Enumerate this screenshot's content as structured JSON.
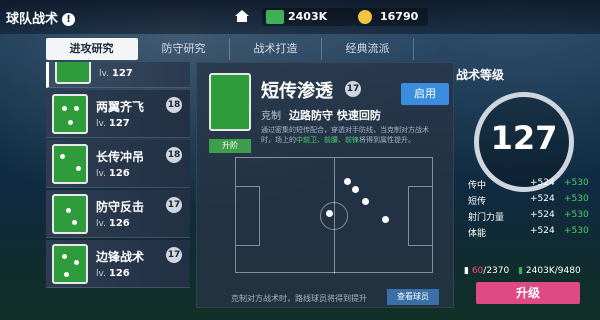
{
  "header": {
    "title": "球队战术",
    "resources": [
      {
        "icon": "cash-icon",
        "value": "2403K"
      },
      {
        "icon": "coin-icon",
        "value": "16790"
      }
    ]
  },
  "tabs": [
    "进攻研究",
    "防守研究",
    "战术打造",
    "经典流派"
  ],
  "tactic_list": [
    {
      "name": "",
      "level_prefix": "lv.",
      "level": "127",
      "badge": ""
    },
    {
      "name": "两翼齐飞",
      "level_prefix": "lv.",
      "level": "127",
      "badge": "18"
    },
    {
      "name": "长传冲吊",
      "level_prefix": "lv.",
      "level": "126",
      "badge": "18"
    },
    {
      "name": "防守反击",
      "level_prefix": "lv.",
      "level": "126",
      "badge": "17"
    },
    {
      "name": "边锋战术",
      "level_prefix": "lv.",
      "level": "126",
      "badge": "17"
    }
  ],
  "detail": {
    "name": "短传渗透",
    "badge": "17",
    "apply_label": "启用",
    "counter_label": "克制",
    "counters": "边路防守 快速回防",
    "desc_prefix": "通过密集的短传配合，穿透对手防线，当克制对方战术时，场上的",
    "desc_green": "中前卫、前腰、前锋",
    "desc_suffix": "将得到属性提升。",
    "upstep_label": "升阶",
    "footnote": "克制对方战术时，路线球员将得到提升",
    "view_players_label": "查看球员"
  },
  "level_panel": {
    "title": "战术等级",
    "level": "127",
    "stats": [
      {
        "name": "传中",
        "base": "+524",
        "bonus": "+530"
      },
      {
        "name": "短传",
        "base": "+524",
        "bonus": "+530"
      },
      {
        "name": "射门力量",
        "base": "+524",
        "bonus": "+530"
      },
      {
        "name": "体能",
        "base": "+524",
        "bonus": "+530"
      }
    ],
    "cost_have": "60",
    "cost_need": "/2370",
    "cost_cash": "2403K",
    "cost_cash_need": "/9480",
    "upgrade_label": "升级"
  }
}
